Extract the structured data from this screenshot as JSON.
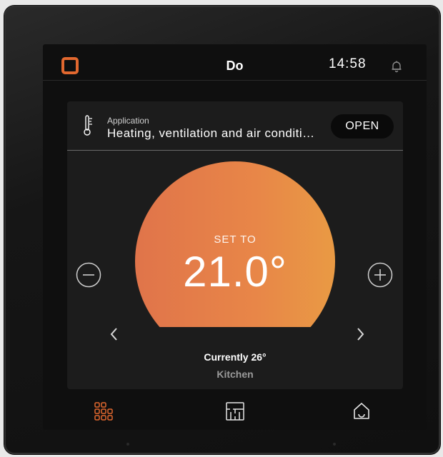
{
  "status_bar": {
    "room": "Do",
    "time": "14:58",
    "logo_icon": "brand-logo-icon",
    "bell_icon": "bell-icon"
  },
  "app_banner": {
    "label": "Application",
    "name": "Heating, ventilation and air conditioning",
    "open_label": "OPEN",
    "icon": "thermometer-icon"
  },
  "thermostat": {
    "set_label": "SET TO",
    "set_value": "21.0°",
    "current": "Currently 26°",
    "location": "Kitchen",
    "decrease_icon": "minus-circle-icon",
    "increase_icon": "plus-circle-icon",
    "dial_colors": [
      "#e0744a",
      "#e99a44"
    ]
  },
  "bottom_nav": {
    "items": [
      {
        "icon": "rooms-grid-icon",
        "active": true
      },
      {
        "icon": "floor-plan-icon",
        "active": false
      },
      {
        "icon": "home-icon",
        "active": false
      }
    ]
  },
  "colors": {
    "accent": "#e2682f",
    "screen_bg": "#0f0f0f",
    "card_bg": "#1c1c1c"
  }
}
